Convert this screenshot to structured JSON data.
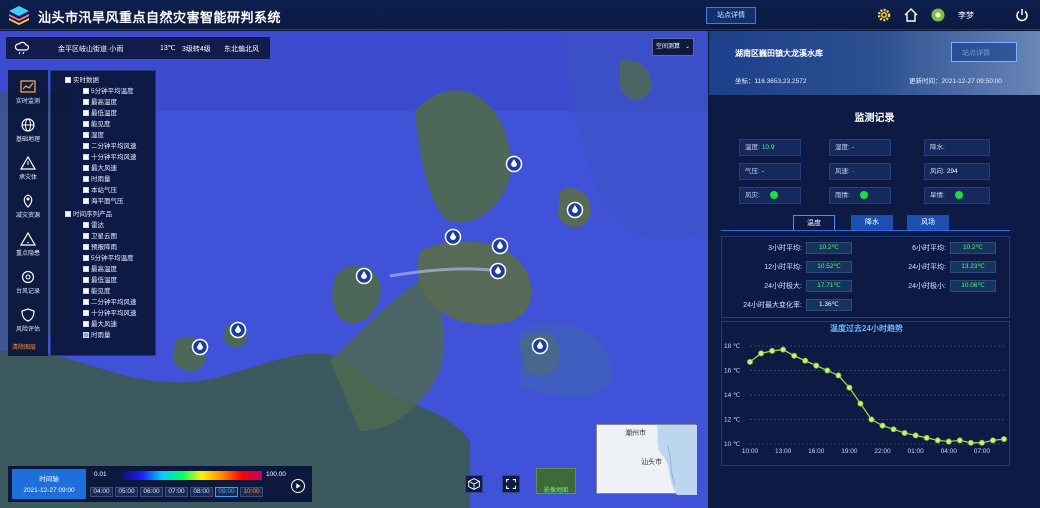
{
  "app": {
    "title": "汕头市汛旱风重点自然灾害智能研判系统",
    "station_btn": "站点详情",
    "user": "李梦"
  },
  "weather": {
    "location": "金平区岐山街道·小雨",
    "temp": "13℃",
    "wind_level": "3级转4级",
    "wind_dir": "东北偏北风"
  },
  "projection_btn": "空间测算",
  "nav": [
    {
      "label": "实时监测",
      "icon": "monitor-icon"
    },
    {
      "label": "基础地理",
      "icon": "globe-icon"
    },
    {
      "label": "承灾体",
      "icon": "warning-icon"
    },
    {
      "label": "减灾资源",
      "icon": "location-icon"
    },
    {
      "label": "重点隐患",
      "icon": "hazard-icon"
    },
    {
      "label": "台风记录",
      "icon": "typhoon-icon"
    },
    {
      "label": "风险评估",
      "icon": "shield-icon"
    }
  ],
  "clear_label": "清除图层",
  "layers": {
    "group1": "实时数据",
    "group1_items": [
      {
        "label": "5分钟平均温度",
        "checked": false
      },
      {
        "label": "最高温度",
        "checked": false
      },
      {
        "label": "最低温度",
        "checked": false
      },
      {
        "label": "能见度",
        "checked": false
      },
      {
        "label": "湿度",
        "checked": false
      },
      {
        "label": "二分钟平均风速",
        "checked": false
      },
      {
        "label": "十分钟平均风速",
        "checked": false
      },
      {
        "label": "最大风速",
        "checked": false
      },
      {
        "label": "时雨量",
        "checked": false
      },
      {
        "label": "本站气压",
        "checked": false
      },
      {
        "label": "海平面气压",
        "checked": false
      }
    ],
    "group2": "时间序列产品",
    "group2_items": [
      {
        "label": "雷达",
        "checked": false
      },
      {
        "label": "卫星云图",
        "checked": false
      },
      {
        "label": "预报降雨",
        "checked": false
      },
      {
        "label": "5分钟平均温度",
        "checked": false
      },
      {
        "label": "最高温度",
        "checked": false
      },
      {
        "label": "最低温度",
        "checked": false
      },
      {
        "label": "能见度",
        "checked": false
      },
      {
        "label": "二分钟平均风速",
        "checked": false
      },
      {
        "label": "十分钟平均风速",
        "checked": false
      },
      {
        "label": "最大风速",
        "checked": false
      },
      {
        "label": "时雨量",
        "checked": true
      }
    ]
  },
  "timeline": {
    "label": "时间轴",
    "datetime": "2021-12-27 09:00",
    "legend_min": "0.01",
    "legend_max": "100.00",
    "slots": [
      "04:00",
      "05:00",
      "06:00",
      "07:00",
      "08:00",
      "09:00",
      "10:00"
    ],
    "active_slot": 5
  },
  "map_tools": {
    "image_map": "影像地图",
    "minimap_city1": "潮州市",
    "minimap_city2": "汕头市"
  },
  "station": {
    "name": "湖南区巍田镇大龙溪水库",
    "detail_btn": "站点详情",
    "coord": "坐标：116.3653,23.2572",
    "update": "更新时间：2021-12-27 09:50:00"
  },
  "record": {
    "title": "监测记录",
    "temp_label": "温度:",
    "temp_value": "10.9",
    "humidity_label": "湿度:",
    "humidity_value": "-",
    "rain_label": "降水:",
    "rain_value": "",
    "pressure_label": "气压:",
    "pressure_value": "-",
    "wind_speed_label": "风速:",
    "wind_speed_value": "-",
    "wind_dir_label": "风向:",
    "wind_dir_value": "294",
    "disaster1": "风灾:",
    "disaster2": "雨情:",
    "disaster3": "旱情:"
  },
  "tabs": [
    "温度",
    "降水",
    "风场"
  ],
  "stats": [
    {
      "label": "3小时平均:",
      "value": "10.2℃"
    },
    {
      "label": "6小时平均:",
      "value": "10.2℃"
    },
    {
      "label": "12小时平均:",
      "value": "10.52℃"
    },
    {
      "label": "24小时平均:",
      "value": "13.23℃"
    },
    {
      "label": "24小时极大:",
      "value": "17.71℃"
    },
    {
      "label": "24小时极小:",
      "value": "10.06℃"
    },
    {
      "label": "24小时最大变化率:",
      "value": "1.36℃"
    }
  ],
  "colors": {
    "accent": "#3f7de0",
    "good": "#19e03a",
    "line": "#9ee64a"
  },
  "chart_data": {
    "type": "line",
    "title": "温度过去24小时趋势",
    "x": [
      "10:00",
      "11:00",
      "12:00",
      "13:00",
      "14:00",
      "15:00",
      "16:00",
      "17:00",
      "18:00",
      "19:00",
      "20:00",
      "21:00",
      "22:00",
      "23:00",
      "00:00",
      "01:00",
      "02:00",
      "03:00",
      "04:00",
      "05:00",
      "06:00",
      "07:00",
      "08:00",
      "09:00"
    ],
    "values": [
      16.7,
      17.4,
      17.6,
      17.7,
      17.2,
      16.8,
      16.4,
      16.0,
      15.6,
      14.6,
      13.3,
      12.0,
      11.5,
      11.2,
      10.9,
      10.7,
      10.5,
      10.3,
      10.2,
      10.3,
      10.1,
      10.1,
      10.3,
      10.4
    ],
    "xticks": [
      "10:00",
      "13:00",
      "16:00",
      "19:00",
      "22:00",
      "01:00",
      "04:00",
      "07:00"
    ],
    "yticks": [
      "10 ℃",
      "12 ℃",
      "14 ℃",
      "16 ℃",
      "18 ℃"
    ],
    "ylim": [
      10,
      18
    ],
    "grid": true
  }
}
